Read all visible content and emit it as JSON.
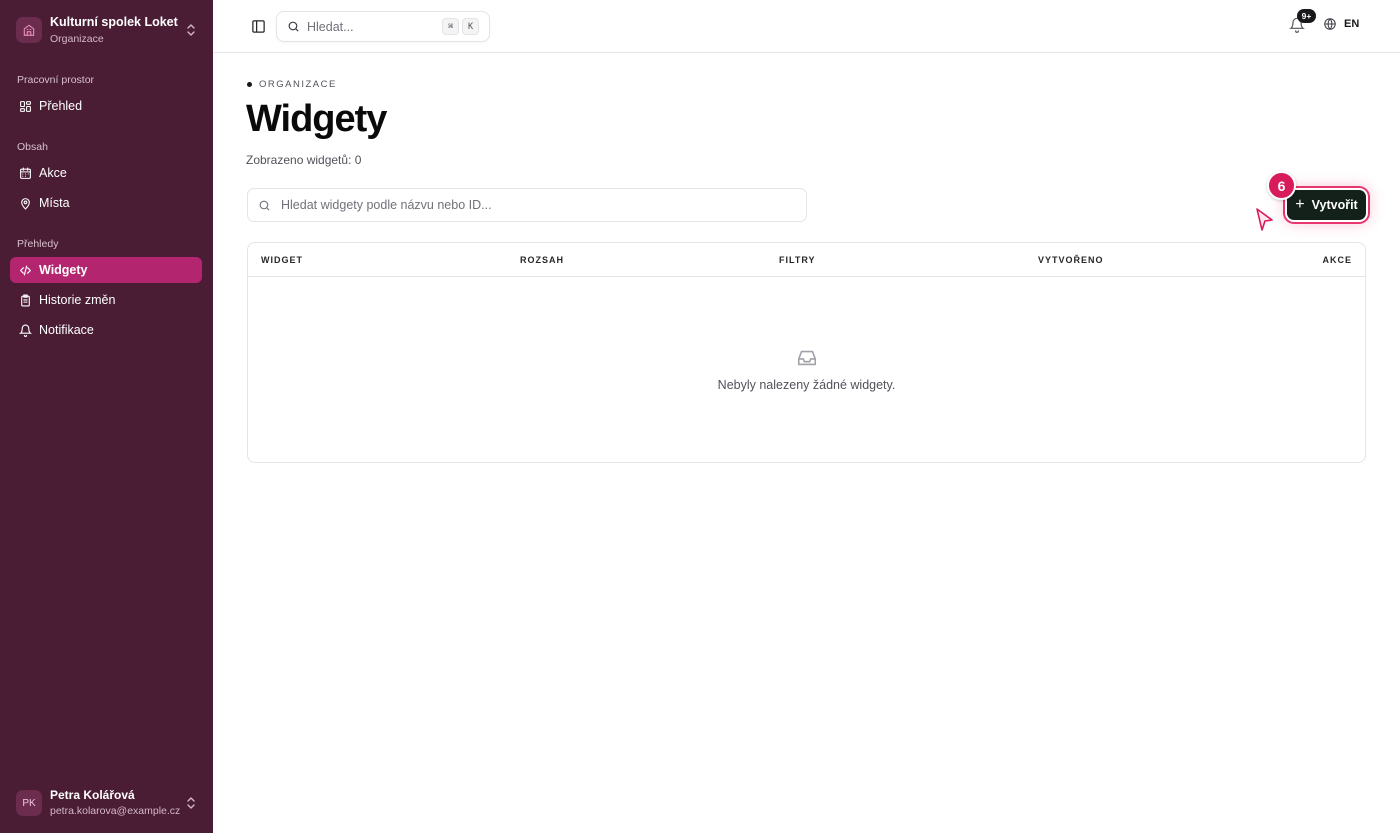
{
  "sidebar": {
    "org_name": "Kulturní spolek Loket",
    "org_type": "Organizace",
    "sections": {
      "workspace": "Pracovní prostor",
      "content": "Obsah",
      "overviews": "Přehledy"
    },
    "items": {
      "overview": "Přehled",
      "events": "Akce",
      "places": "Místa",
      "widgets": "Widgety",
      "history": "Historie změn",
      "notifications": "Notifikace"
    },
    "active_item": "Widgety",
    "user": {
      "initials": "PK",
      "name": "Petra Kolářová",
      "email": "petra.kolarova@example.cz"
    }
  },
  "topbar": {
    "search_placeholder": "Hledat...",
    "shortcut_keys": [
      "⌘",
      "K"
    ],
    "notification_badge": "9+",
    "language": "EN"
  },
  "main": {
    "breadcrumb": "ORGANIZACE",
    "title": "Widgety",
    "count_text": "Zobrazeno widgetů: 0",
    "search_placeholder": "Hledat widgety podle názvu nebo ID...",
    "create_label": "Vytvořit",
    "step_badge": "6",
    "table": {
      "columns": [
        "WIDGET",
        "ROZSAH",
        "FILTRY",
        "VYTVOŘENO",
        "AKCE"
      ],
      "rows": [],
      "empty_text": "Nebyly nalezeny žádné widgety."
    }
  },
  "colors": {
    "sidebar_bg": "#4a1d35",
    "active_item": "#b3266f",
    "create_button": "#14201a",
    "highlight": "#e9356f"
  }
}
